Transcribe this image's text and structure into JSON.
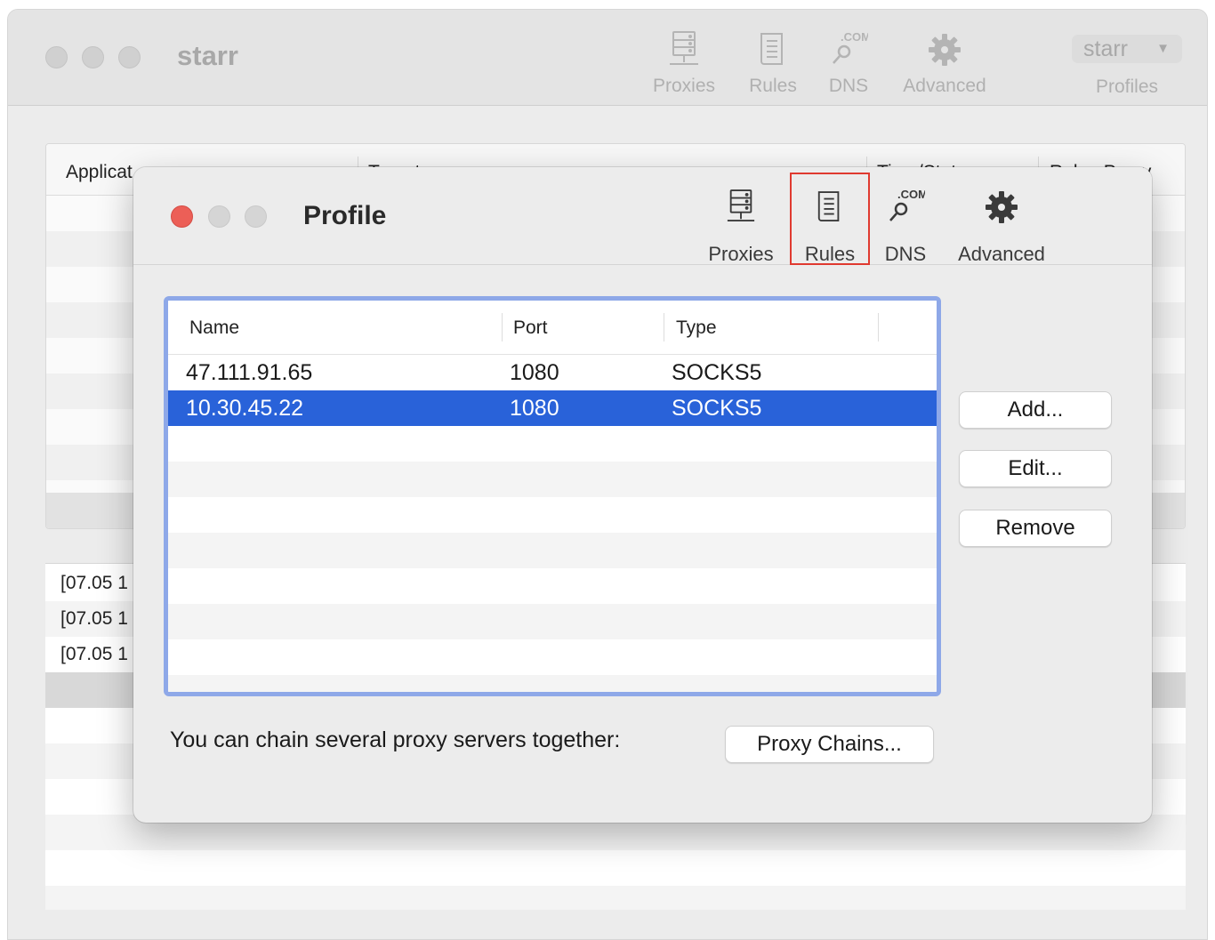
{
  "main_window": {
    "title": "starr",
    "toolbar": [
      {
        "label": "Proxies",
        "icon": "server-icon"
      },
      {
        "label": "Rules",
        "icon": "document-icon"
      },
      {
        "label": "DNS",
        "icon": "dns-search-icon"
      },
      {
        "label": "Advanced",
        "icon": "gear-icon"
      }
    ],
    "dns_badge": ".COM",
    "profiles": {
      "selected": "starr",
      "label": "Profiles"
    },
    "connections_table": {
      "columns": [
        "Applicat…",
        "Target",
        "Time/Status",
        "Rule : Proxy"
      ]
    },
    "log_lines": [
      "[07.05 1",
      "[07.05 1",
      "[07.05 1"
    ]
  },
  "profile_sheet": {
    "title": "Profile",
    "toolbar": [
      {
        "label": "Proxies",
        "icon": "server-icon"
      },
      {
        "label": "Rules",
        "icon": "document-icon",
        "highlighted": true
      },
      {
        "label": "DNS",
        "icon": "dns-search-icon"
      },
      {
        "label": "Advanced",
        "icon": "gear-icon"
      }
    ],
    "dns_badge": ".COM",
    "proxy_table": {
      "columns": [
        "Name",
        "Port",
        "Type"
      ],
      "rows": [
        {
          "name": "47.111.91.65",
          "port": "1080",
          "type": "SOCKS5",
          "selected": false
        },
        {
          "name": "10.30.45.22",
          "port": "1080",
          "type": "SOCKS5",
          "selected": true
        }
      ]
    },
    "buttons": {
      "add": "Add...",
      "edit": "Edit...",
      "remove": "Remove"
    },
    "chain_text": "You can chain several proxy servers together:",
    "chain_button": "Proxy Chains..."
  },
  "colors": {
    "selection": "#2962d9",
    "focus_ring": "#8ea8e8",
    "highlight_box": "#e03a30",
    "close_button": "#ec5f57"
  }
}
